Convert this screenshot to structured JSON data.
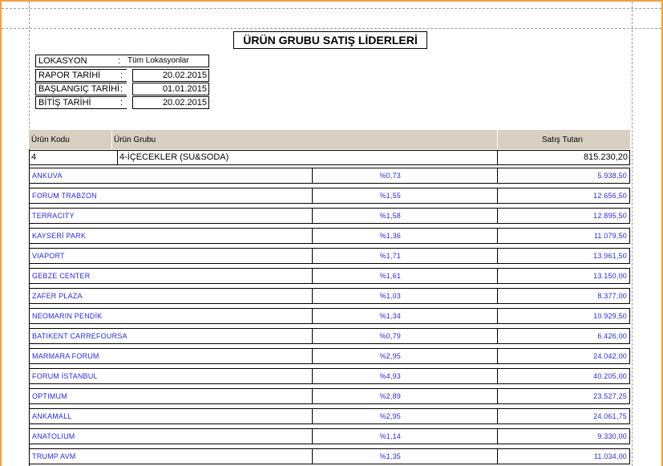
{
  "report": {
    "title": "ÜRÜN GRUBU SATIŞ LİDERLERİ",
    "info": [
      {
        "label": "LOKASYON",
        "colon": ":",
        "value": "Tüm Lokasyonlar"
      },
      {
        "label": "RAPOR TARİHİ",
        "colon": ":",
        "value": "20.02.2015"
      },
      {
        "label": "BAŞLANGIÇ TARİHİ",
        "colon": ":",
        "value": "01.01.2015"
      },
      {
        "label": "BİTİŞ TARİHİ",
        "colon": ":",
        "value": "20.02.2015"
      }
    ]
  },
  "table": {
    "headers": {
      "code": "Ürün Kodu",
      "group": "Ürün Grubu",
      "total": "Satış Tutarı"
    },
    "group": {
      "code": "4",
      "name": "4-İÇECEKLER (SU&SODA)",
      "total": "815.230,20"
    },
    "rows": [
      {
        "store": "ANKUVA",
        "pct": "%0,73",
        "amount": "5.938,50"
      },
      {
        "store": "FORUM TRABZON",
        "pct": "%1,55",
        "amount": "12.656,50"
      },
      {
        "store": "TERRACITY",
        "pct": "%1,58",
        "amount": "12.895,50"
      },
      {
        "store": "KAYSERİ PARK",
        "pct": "%1,36",
        "amount": "11.079,50"
      },
      {
        "store": "VIAPORT",
        "pct": "%1,71",
        "amount": "13.961,50"
      },
      {
        "store": "GEBZE CENTER",
        "pct": "%1,61",
        "amount": "13.150,00"
      },
      {
        "store": "ZAFER PLAZA",
        "pct": "%1,03",
        "amount": "8.377,00"
      },
      {
        "store": "NEOMARIN PENDİK",
        "pct": "%1,34",
        "amount": "10.929,50"
      },
      {
        "store": "BATIKENT CARREFOURSA",
        "pct": "%0,79",
        "amount": "6.426,00"
      },
      {
        "store": "MARMARA FORUM",
        "pct": "%2,95",
        "amount": "24.042,00"
      },
      {
        "store": "FORUM İSTANBUL",
        "pct": "%4,93",
        "amount": "40.205,00"
      },
      {
        "store": "OPTIMUM",
        "pct": "%2,89",
        "amount": "23.527,25"
      },
      {
        "store": "ANKAMALL",
        "pct": "%2,95",
        "amount": "24.061,75"
      },
      {
        "store": "ANATOLIUM",
        "pct": "%1,14",
        "amount": "9.330,00"
      },
      {
        "store": "TRUMP AVM",
        "pct": "%1,35",
        "amount": "11.034,00"
      }
    ]
  }
}
